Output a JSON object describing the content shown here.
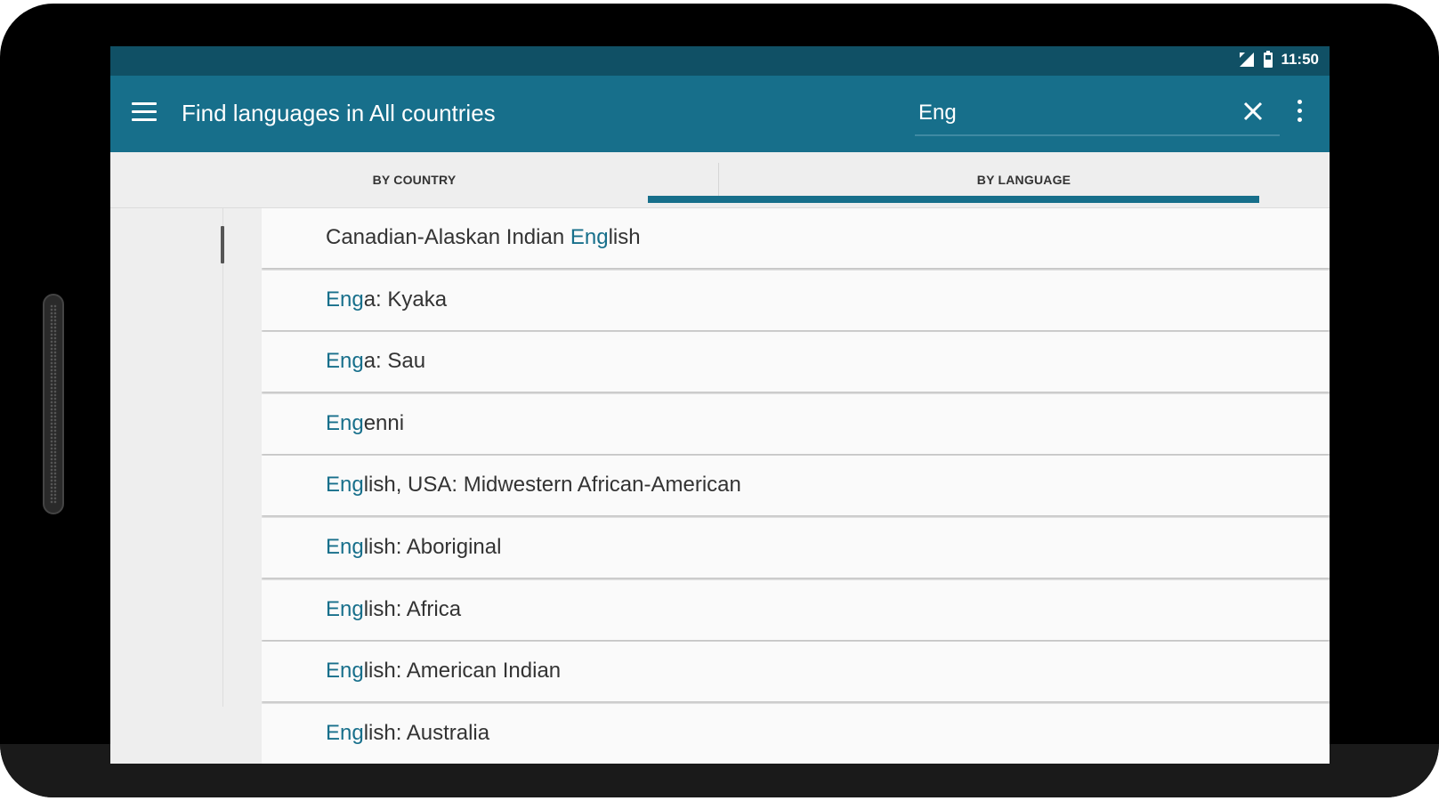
{
  "status_bar": {
    "time": "11:50",
    "icons": [
      "signal-icon",
      "battery-icon"
    ]
  },
  "app_bar": {
    "title": "Find languages in All countries",
    "search_value": "Eng",
    "icons": [
      "menu-icon",
      "close-icon",
      "overflow-menu-icon"
    ]
  },
  "tabs": [
    {
      "label": "BY COUNTRY",
      "active": false
    },
    {
      "label": "BY LANGUAGE",
      "active": true
    }
  ],
  "colors": {
    "status_bar": "#105065",
    "app_bar": "#176f8b",
    "highlight": "#176f8b"
  },
  "languages": [
    {
      "before": "Canadian-Alaskan Indian ",
      "match": "Eng",
      "after": "lish"
    },
    {
      "before": "",
      "match": "Eng",
      "after": "a: Kyaka"
    },
    {
      "before": "",
      "match": "Eng",
      "after": "a: Sau"
    },
    {
      "before": "",
      "match": "Eng",
      "after": "enni"
    },
    {
      "before": "",
      "match": "Eng",
      "after": "lish, USA: Midwestern African-American"
    },
    {
      "before": "",
      "match": "Eng",
      "after": "lish: Aboriginal"
    },
    {
      "before": "",
      "match": "Eng",
      "after": "lish: Africa"
    },
    {
      "before": "",
      "match": "Eng",
      "after": "lish: American Indian"
    },
    {
      "before": "",
      "match": "Eng",
      "after": "lish: Australia"
    }
  ]
}
